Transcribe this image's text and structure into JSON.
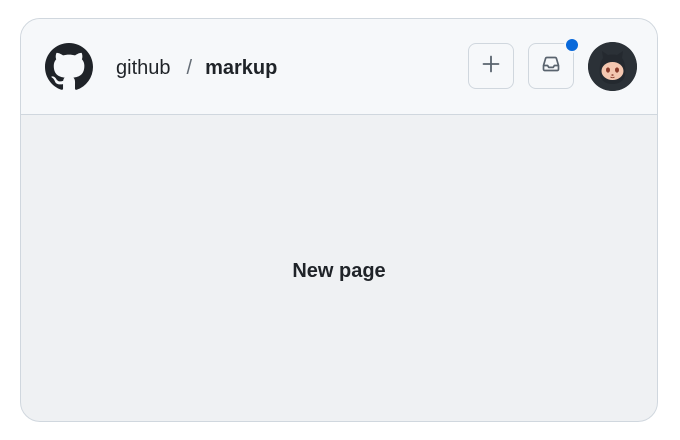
{
  "header": {
    "logo_icon": "github-mark-icon",
    "breadcrumb": {
      "owner": "github",
      "separator": "/",
      "repo": "markup"
    },
    "actions": {
      "create_icon": "plus-icon",
      "inbox_icon": "inbox-icon",
      "inbox_has_unread": true,
      "unread_color": "#0969da"
    },
    "avatar_icon": "octocat-avatar"
  },
  "main": {
    "text": "New page"
  },
  "colors": {
    "header_bg": "#f6f8fa",
    "body_bg": "#eff1f3",
    "border": "#d0d7de",
    "text": "#1f2328"
  }
}
